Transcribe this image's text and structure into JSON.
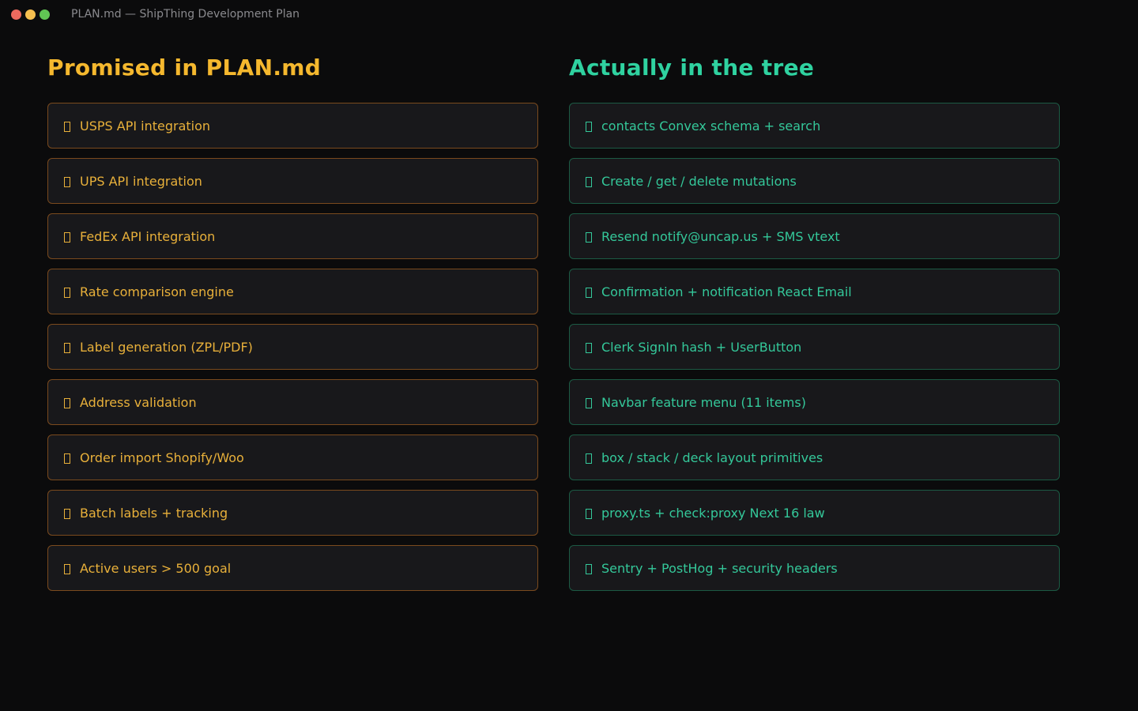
{
  "window": {
    "title": "PLAN.md — ShipThing Development Plan",
    "traffic_lights": {
      "close": "#ed6a5e",
      "minimize": "#f5bf4f",
      "maximize": "#61c554"
    }
  },
  "colors": {
    "promised_accent": "#f5b82e",
    "promised_text": "#e8b03a",
    "promised_border": "#7a4a1e",
    "actual_accent": "#2fd2a0",
    "actual_text": "#34c89a",
    "actual_border": "#1c5a44"
  },
  "promised": {
    "heading": "Promised in PLAN.md",
    "item_icon": "missing-glyph-icon",
    "items": [
      "USPS API integration",
      "UPS API integration",
      "FedEx API integration",
      "Rate comparison engine",
      "Label generation (ZPL/PDF)",
      "Address validation",
      "Order import Shopify/Woo",
      "Batch labels + tracking",
      "Active users > 500 goal"
    ]
  },
  "actual": {
    "heading": "Actually in the tree",
    "item_icon": "missing-glyph-icon",
    "items": [
      "contacts Convex schema + search",
      "Create / get / delete mutations",
      "Resend notify@uncap.us + SMS vtext",
      "Confirmation + notification React Email",
      "Clerk SignIn hash + UserButton",
      "Navbar feature menu (11 items)",
      "box / stack / deck layout primitives",
      "proxy.ts + check:proxy Next 16 law",
      "Sentry + PostHog + security headers"
    ]
  }
}
